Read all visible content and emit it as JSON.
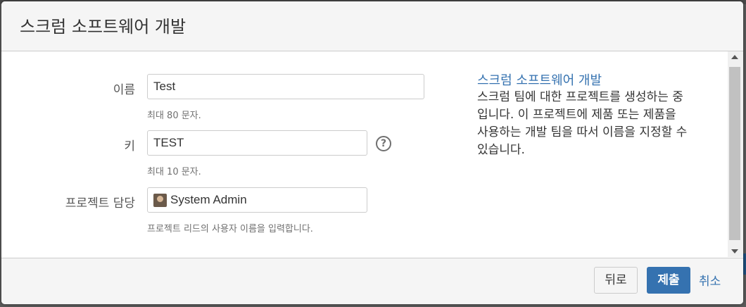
{
  "dialog": {
    "title": "스크럼 소프트웨어 개발"
  },
  "form": {
    "name": {
      "label": "이름",
      "value": "Test",
      "description": "최대 80 문자."
    },
    "key": {
      "label": "키",
      "value": "TEST",
      "description": "최대 10 문자.",
      "help_icon": "question-circle-icon"
    },
    "lead": {
      "label": "프로젝트 담당",
      "value": "System Admin",
      "description": "프로젝트 리드의 사용자 이름을 입력합니다."
    }
  },
  "info": {
    "title": "스크럼 소프트웨어 개발",
    "lines": [
      "스크럼 팀에 대한 프로젝트를 생성하는 중",
      "입니다. 이 프로젝트에 제품 또는 제품을",
      "사용하는 개발 팀을 따서 이름을 지정할 수",
      "있습니다."
    ]
  },
  "footer": {
    "back_label": "뒤로",
    "submit_label": "제출",
    "cancel_label": "취소"
  },
  "colors": {
    "accent": "#3572b0",
    "header_bg": "#f5f5f5"
  }
}
